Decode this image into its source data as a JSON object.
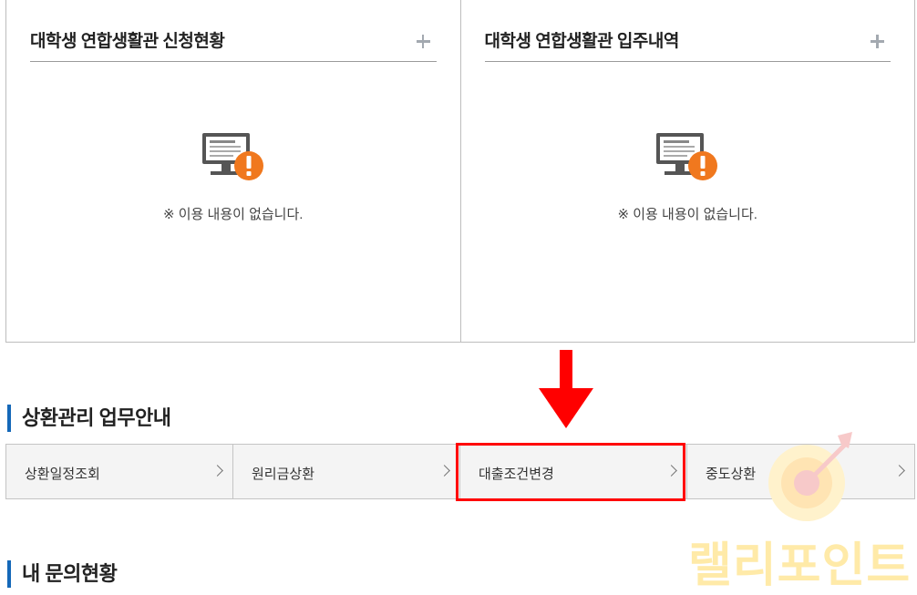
{
  "panels": [
    {
      "title": "대학생 연합생활관 신청현황",
      "empty_text": "※ 이용 내용이 없습니다."
    },
    {
      "title": "대학생 연합생활관 입주내역",
      "empty_text": "※ 이용 내용이 없습니다."
    }
  ],
  "repayment_section": {
    "title": "상환관리 업무안내",
    "tabs": [
      {
        "label": "상환일정조회"
      },
      {
        "label": "원리금상환"
      },
      {
        "label": "대출조건변경",
        "highlighted": true
      },
      {
        "label": "중도상환"
      }
    ]
  },
  "inquiry_section": {
    "title": "내 문의현황"
  },
  "watermark": {
    "text": "랠리포인트"
  },
  "colors": {
    "accent": "#1468b8",
    "highlight": "#ff0000",
    "empty_icon_orange": "#f0781e",
    "monitor": "#555555",
    "watermark": "#ffeaa8"
  },
  "icons": [
    "plus-icon",
    "monitor-warning-icon",
    "chevron-right-icon",
    "down-arrow-icon",
    "target-logo-icon"
  ]
}
